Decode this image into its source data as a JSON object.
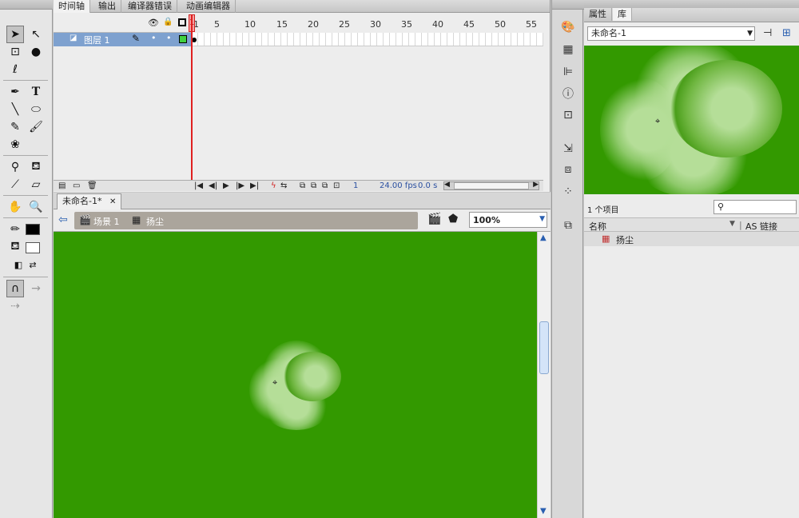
{
  "timeline": {
    "tabs": [
      "时间轴",
      "输出",
      "编译器错误",
      "动画编辑器"
    ],
    "frame_numbers": [
      "1",
      "5",
      "10",
      "15",
      "20",
      "25",
      "30",
      "35",
      "40",
      "45",
      "50",
      "55"
    ],
    "layer_name": "图层 1",
    "current_frame": "1",
    "fps": "24.00 fps",
    "time": "0.0 s"
  },
  "document": {
    "tab_label": "未命名-1*",
    "scene": "场景 1",
    "symbol": "扬尘",
    "zoom": "100%"
  },
  "right_panel": {
    "tabs": [
      "属性",
      "库"
    ],
    "library_name": "未命名-1",
    "item_count": "1 个项目",
    "col_name": "名称",
    "col_linkage": "AS 链接",
    "items": [
      {
        "name": "扬尘"
      }
    ]
  },
  "colors": {
    "stage": "#339900",
    "layer_highlight": "#7ea1cf",
    "playhead": "#e02020"
  }
}
